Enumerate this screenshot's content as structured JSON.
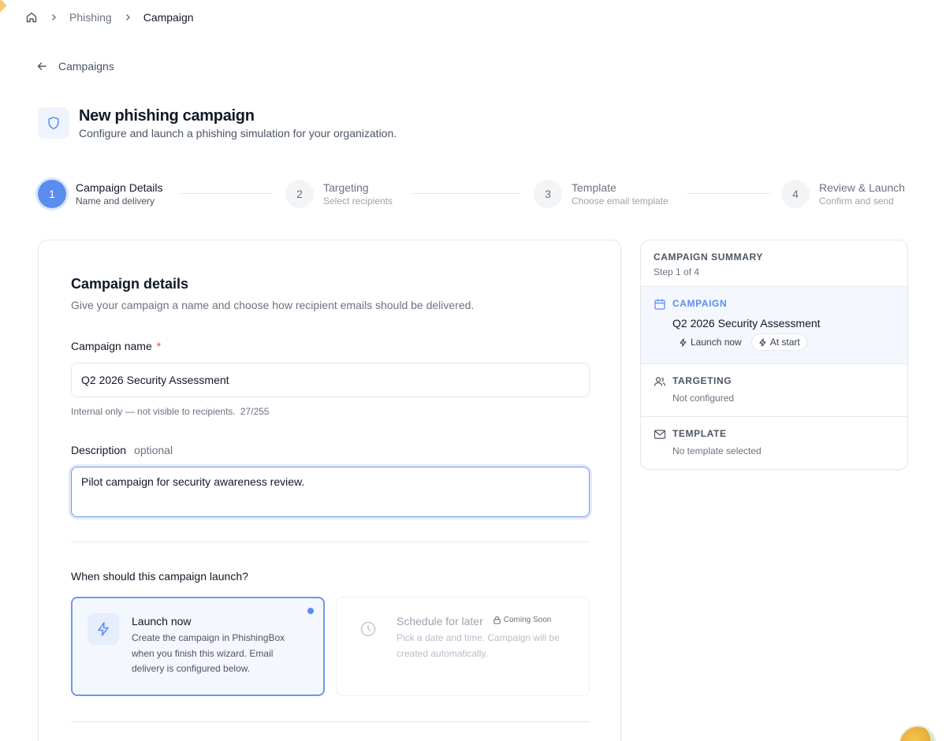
{
  "breadcrumb": {
    "items": [
      "Phishing",
      "Campaign"
    ]
  },
  "back": {
    "label": "Campaigns"
  },
  "header": {
    "title": "New phishing campaign",
    "subtitle": "Configure and launch a phishing simulation for your organization."
  },
  "steps": [
    {
      "number": "1",
      "label": "Campaign Details",
      "sub": "Name and delivery",
      "state": "active"
    },
    {
      "number": "2",
      "label": "Targeting",
      "sub": "Select recipients",
      "state": "inactive"
    },
    {
      "number": "3",
      "label": "Template",
      "sub": "Choose email template",
      "state": "inactive"
    },
    {
      "number": "4",
      "label": "Review & Launch",
      "sub": "Confirm and send",
      "state": "inactive"
    }
  ],
  "form": {
    "title": "Campaign details",
    "description": "Give your campaign a name and choose how recipient emails should be delivered.",
    "name_label": "Campaign name",
    "required_mark": "*",
    "name_value": "Q2 2026 Security Assessment",
    "name_hint": "Internal only — not visible to recipients.",
    "name_count": "27/255",
    "desc_label": "Description",
    "desc_optional": "optional",
    "desc_value": "Pilot campaign for security awareness review.",
    "launch_question": "When should this campaign launch?",
    "options": {
      "launch_now": {
        "title": "Launch now",
        "desc": "Create the campaign in PhishingBox when you finish this wizard. Email delivery is configured below."
      },
      "schedule": {
        "title": "Schedule for later",
        "badge": "Coming Soon",
        "desc": "Pick a date and time. Campaign will be created automatically."
      }
    }
  },
  "summary": {
    "heading": "CAMPAIGN SUMMARY",
    "step_info": "Step 1 of 4",
    "campaign": {
      "caption": "CAMPAIGN",
      "name": "Q2 2026 Security Assessment",
      "chips": [
        "Launch now",
        "At start"
      ]
    },
    "targeting": {
      "caption": "TARGETING",
      "value": "Not configured"
    },
    "template": {
      "caption": "TEMPLATE",
      "value": "No template selected"
    }
  },
  "colors": {
    "accent": "#5b8def",
    "required": "#ef4444",
    "border": "#e5e7eb"
  },
  "icons": [
    "home-icon",
    "chevron-right-icon",
    "arrow-left-icon",
    "shield-icon",
    "bolt-icon",
    "clock-icon",
    "lock-icon",
    "calendar-icon",
    "users-icon",
    "mail-icon"
  ]
}
